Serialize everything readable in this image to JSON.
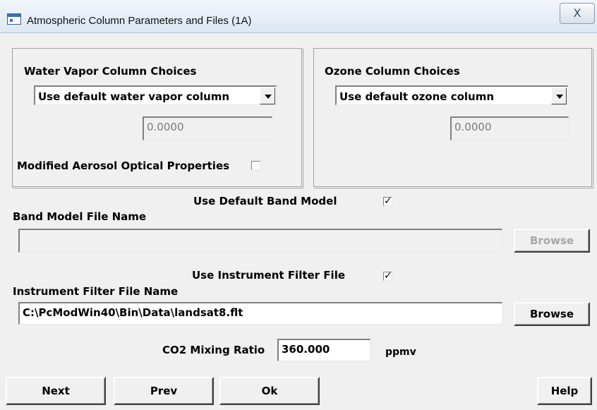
{
  "window": {
    "title": "Atmospheric Column Parameters and Files (1A)",
    "close_glyph": "X",
    "icon": "window-icon"
  },
  "water_vapor": {
    "heading": "Water Vapor Column Choices",
    "selected": "Use default water vapor column",
    "value": "0.0000"
  },
  "ozone": {
    "heading": "Ozone Column Choices",
    "selected": "Use default ozone column",
    "value": "0.0000"
  },
  "aerosol": {
    "label": "Modified Aerosol Optical Properties",
    "checked": false
  },
  "band_model": {
    "use_default_label": "Use Default Band Model",
    "use_default_checked": true,
    "file_label": "Band Model File Name",
    "file_value": "",
    "browse_label": "Browse"
  },
  "instrument_filter": {
    "use_label": "Use Instrument Filter File",
    "use_checked": true,
    "file_label": "Instrument Filter File Name",
    "file_value": "C:\\PcModWin40\\Bin\\Data\\landsat8.flt",
    "browse_label": "Browse"
  },
  "co2": {
    "label": "CO2 Mixing Ratio",
    "value": "360.000",
    "unit": "ppmv"
  },
  "buttons": {
    "next": "Next",
    "prev": "Prev",
    "ok": "Ok",
    "help": "Help"
  },
  "check_glyph": "✓"
}
